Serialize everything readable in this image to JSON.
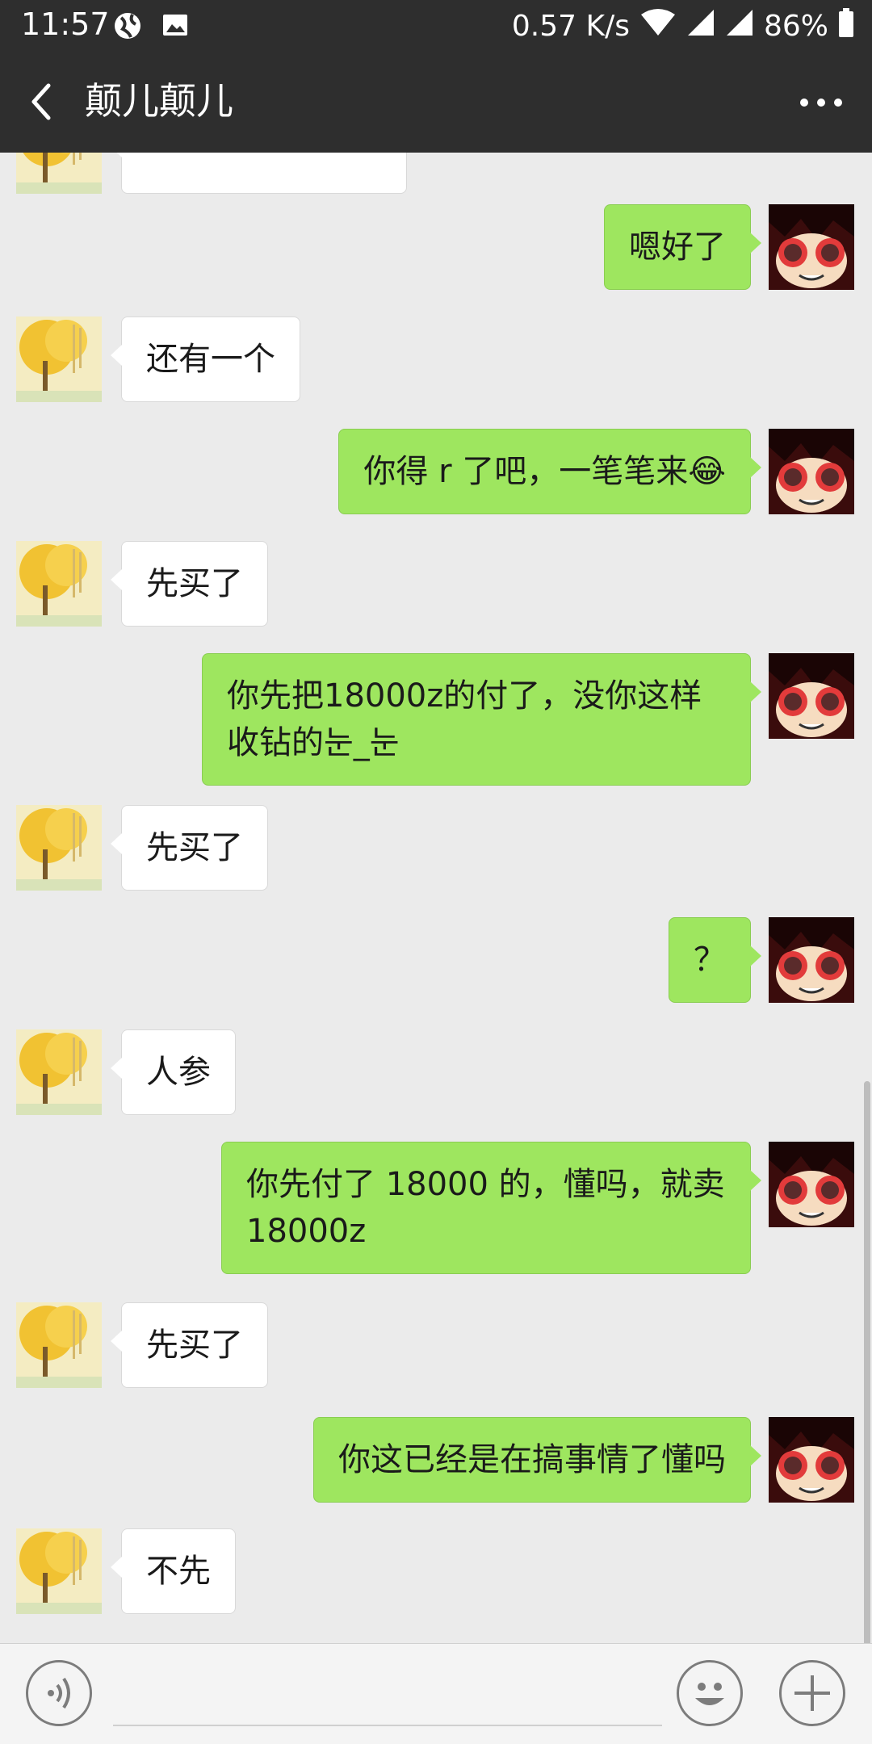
{
  "status_bar": {
    "time": "11:57",
    "net_speed": "0.57 K/s",
    "battery": "86%",
    "icons": [
      "vpn-globe-icon",
      "image-icon",
      "wifi-icon",
      "signal-icon",
      "signal-icon",
      "battery-icon"
    ]
  },
  "header": {
    "title": "颠儿颠儿",
    "back_icon": "back-chevron-icon",
    "more_icon": "more-dots-icon"
  },
  "messages": [
    {
      "side": "in",
      "text": ""
    },
    {
      "side": "out",
      "text": "嗯好了"
    },
    {
      "side": "in",
      "text": "还有一个"
    },
    {
      "side": "out",
      "text": "你得 r 了吧，一笔笔来😂"
    },
    {
      "side": "in",
      "text": "先买了"
    },
    {
      "side": "out",
      "text": "你先把18000z的付了，没你这样收钻的눈_눈"
    },
    {
      "side": "in",
      "text": "先买了"
    },
    {
      "side": "out",
      "text": "？"
    },
    {
      "side": "in",
      "text": "人参"
    },
    {
      "side": "out",
      "text": "你先付了 18000 的，懂吗，就卖 18000z"
    },
    {
      "side": "in",
      "text": "先买了"
    },
    {
      "side": "out",
      "text": "你这已经是在搞事情了懂吗"
    },
    {
      "side": "in",
      "text": "不先"
    }
  ],
  "input_bar": {
    "voice_icon": "voice-icon",
    "emoji_icon": "emoji-icon",
    "plus_icon": "plus-icon"
  },
  "colors": {
    "header_bg": "#2e2e2e",
    "chat_bg": "#ebebeb",
    "outgoing_bubble": "#9ee65f",
    "incoming_bubble": "#ffffff"
  }
}
